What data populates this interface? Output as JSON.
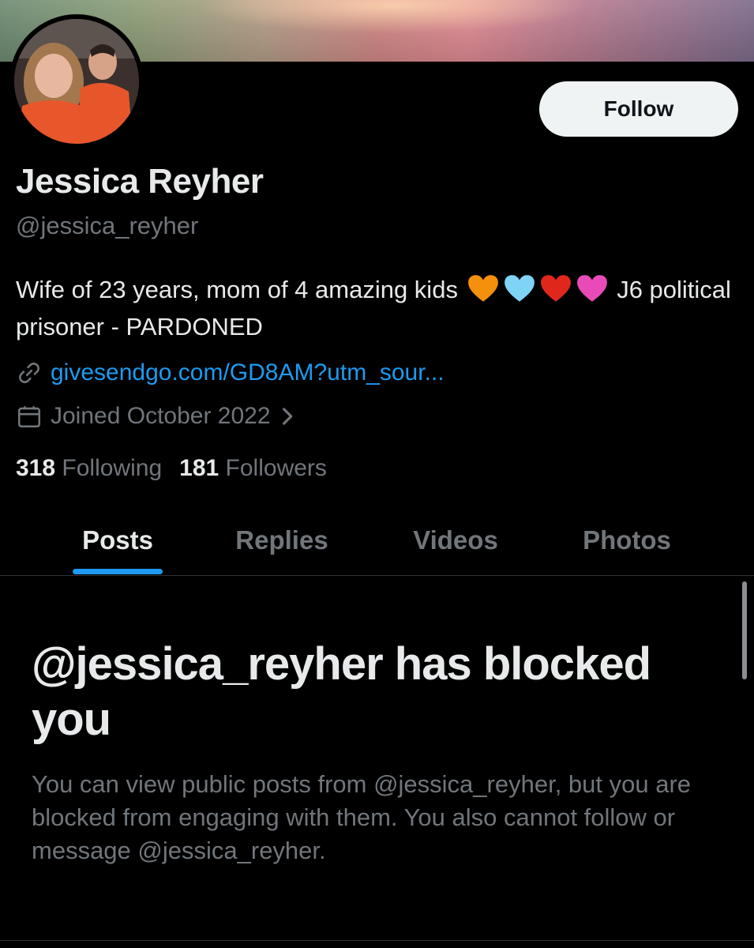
{
  "profile": {
    "display_name": "Jessica Reyher",
    "handle": "@jessica_reyher",
    "follow_label": "Follow",
    "bio_part1": "Wife of 23 years, mom of 4 amazing kids",
    "bio_part2": "J6 political prisoner - PARDONED",
    "bio_hearts": [
      "orange-heart-icon",
      "light-blue-heart-icon",
      "red-heart-icon",
      "pink-heart-icon"
    ],
    "link": "givesendgo.com/GD8AM?utm_sour...",
    "joined": "Joined October 2022",
    "following_count": "318",
    "following_label": "Following",
    "followers_count": "181",
    "followers_label": "Followers"
  },
  "tabs": [
    {
      "label": "Posts",
      "active": true
    },
    {
      "label": "Replies",
      "active": false
    },
    {
      "label": "Videos",
      "active": false
    },
    {
      "label": "Photos",
      "active": false
    }
  ],
  "blocked": {
    "title": "@jessica_reyher has blocked you",
    "description": "You can view public posts from @jessica_reyher, but you are blocked from engaging with them. You also cannot follow or message @jessica_reyher."
  },
  "colors": {
    "background": "#000000",
    "text_primary": "#e7e9ea",
    "text_secondary": "#71767b",
    "accent": "#1d9bf0",
    "button_bg": "#eff3f4"
  }
}
